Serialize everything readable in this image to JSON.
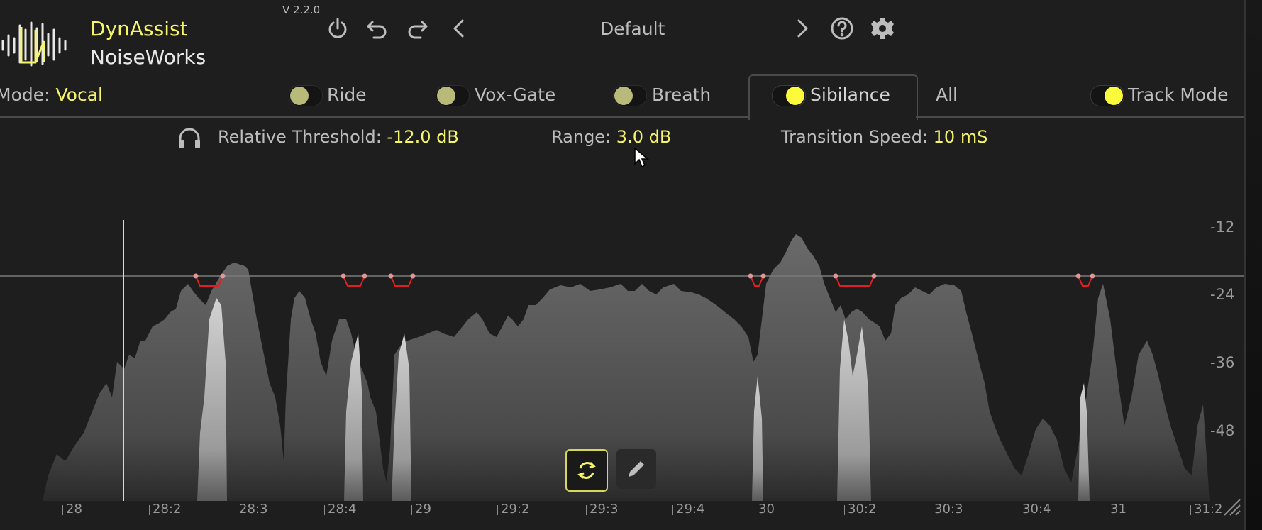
{
  "header": {
    "brand_line1": "DynAssist",
    "brand_line2": "NoiseWorks",
    "version": "V 2.2.0",
    "preset_name": "Default",
    "icons": [
      "power-icon",
      "undo-icon",
      "redo-icon",
      "prev-preset-icon",
      "next-preset-icon",
      "help-icon",
      "settings-gear-icon"
    ]
  },
  "mode": {
    "label": "Mode:",
    "value": "Vocal"
  },
  "tabs": [
    {
      "label": "Ride",
      "enabled": false
    },
    {
      "label": "Vox-Gate",
      "enabled": false
    },
    {
      "label": "Breath",
      "enabled": false
    },
    {
      "label": "Sibilance",
      "enabled": true,
      "active": true
    },
    {
      "label": "All"
    }
  ],
  "track_mode": {
    "label": "Track Mode",
    "enabled": true
  },
  "params": {
    "threshold_label": "Relative Threshold:",
    "threshold_value": "-12.0 dB",
    "range_label": "Range:",
    "range_value": "3.0 dB",
    "speed_label": "Transition Speed:",
    "speed_value": "10 mS"
  },
  "y_axis": [
    "-12",
    "-24",
    "-36",
    "-48"
  ],
  "timeline": [
    "28",
    "28:2",
    "28:3",
    "28:4",
    "29",
    "29:2",
    "29:3",
    "29:4",
    "30",
    "30:2",
    "30:3",
    "30:4",
    "31",
    "31:2"
  ],
  "tools": [
    "loop-refresh-icon",
    "pencil-icon"
  ],
  "colors": {
    "accent": "#f5f56a",
    "text": "#bdbdbd",
    "background": "#1e1e1e",
    "marker": "#e02020"
  }
}
